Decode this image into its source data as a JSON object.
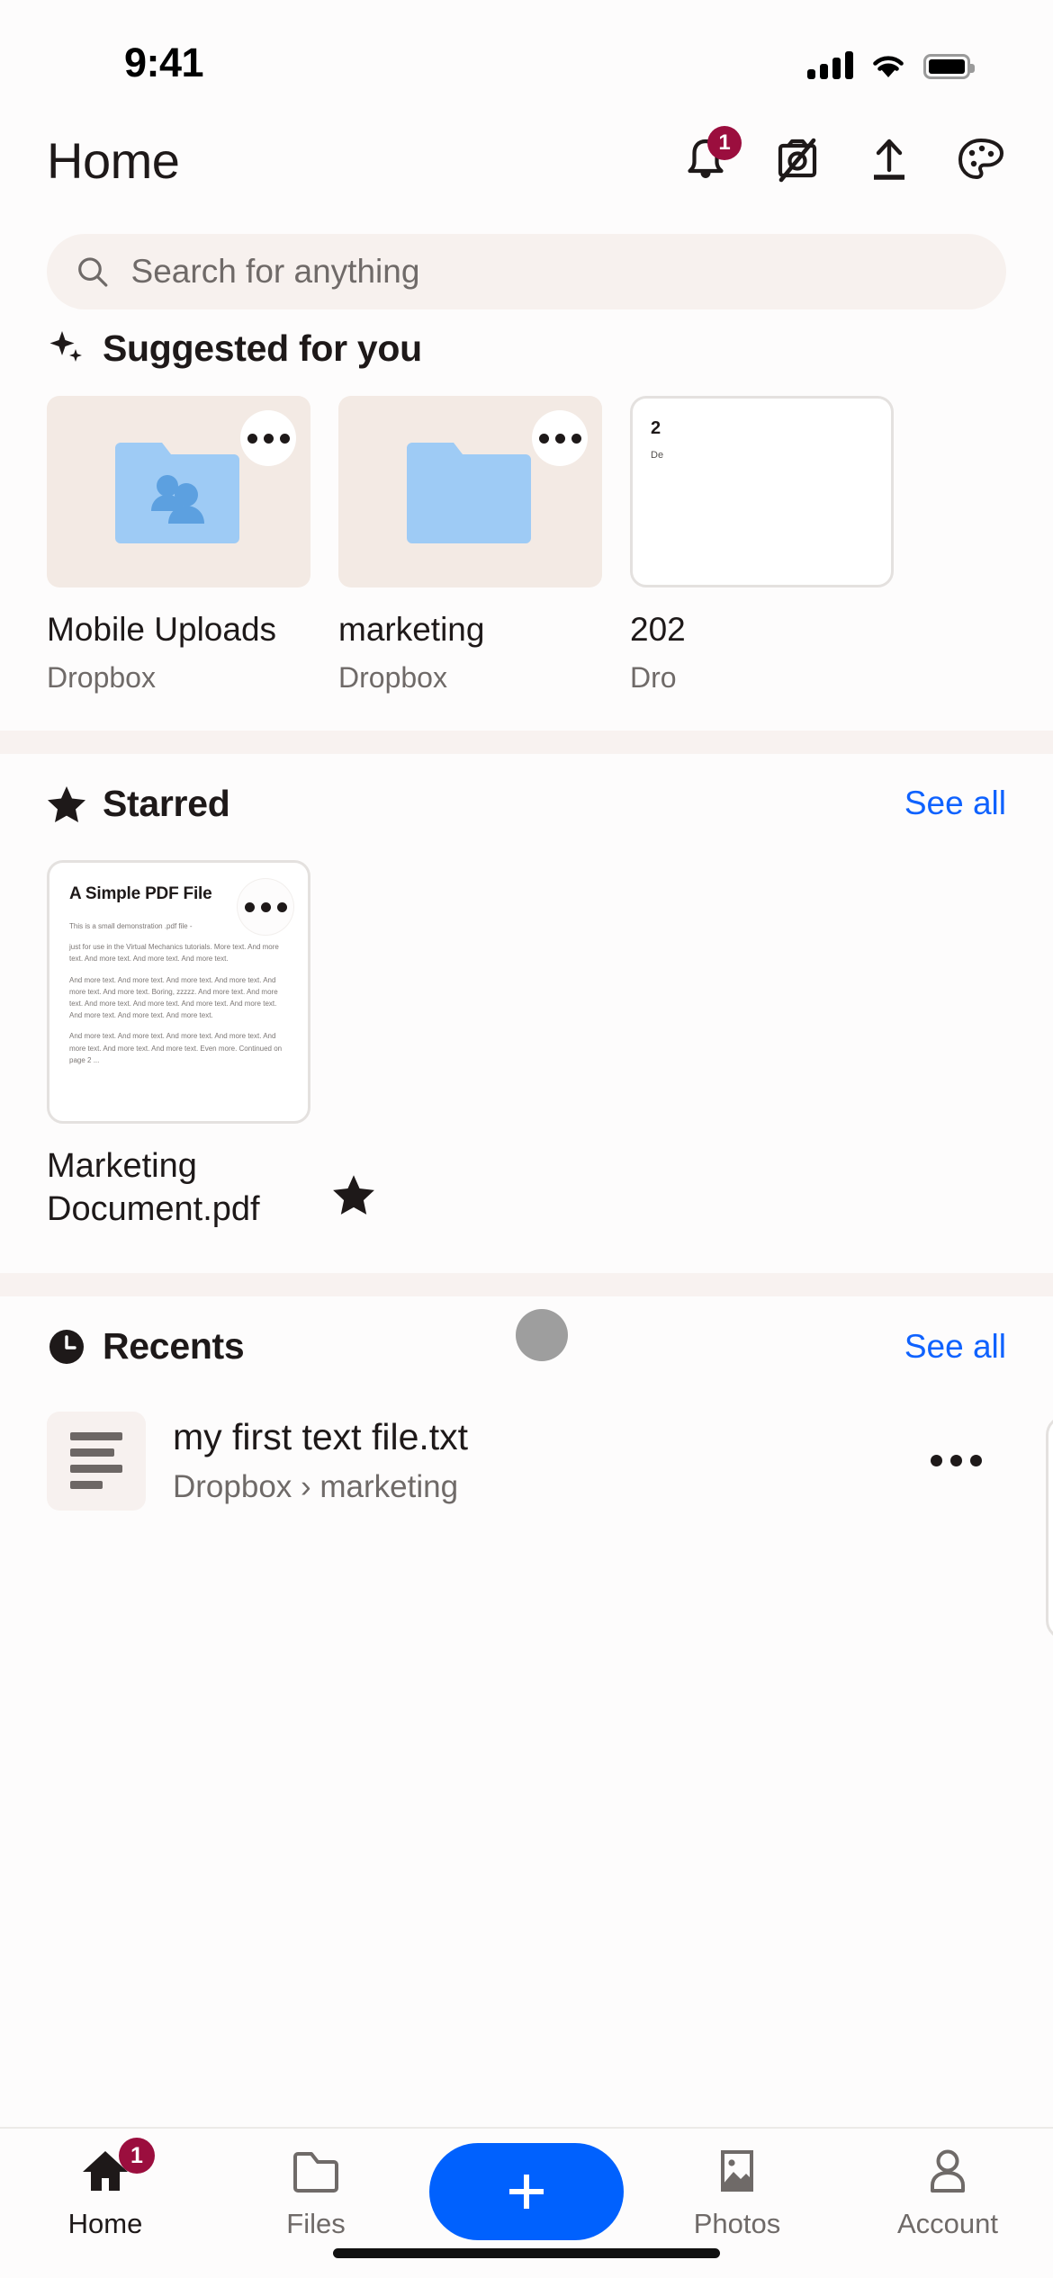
{
  "status_bar": {
    "time": "9:41",
    "cellular_icon": "signal-bars-icon",
    "wifi_icon": "wifi-icon",
    "battery_icon": "battery-full-icon"
  },
  "header": {
    "title": "Home",
    "actions": [
      {
        "name": "notifications-button",
        "icon": "bell-icon",
        "badge": "1"
      },
      {
        "name": "camera-uploads-button",
        "icon": "camera-slash-icon"
      },
      {
        "name": "upload-button",
        "icon": "upload-arrow-icon"
      },
      {
        "name": "theme-button",
        "icon": "palette-icon"
      }
    ]
  },
  "search": {
    "placeholder": "Search for anything",
    "value": "",
    "icon": "search-icon"
  },
  "suggested": {
    "title": "Suggested for you",
    "icon": "sparkle-icon",
    "cards": [
      {
        "name": "Mobile Uploads",
        "subtitle": "Dropbox",
        "kind": "shared-folder",
        "menu": "overflow-menu-icon"
      },
      {
        "name": "marketing",
        "subtitle": "Dropbox",
        "kind": "folder",
        "menu": "overflow-menu-icon"
      },
      {
        "name": "202",
        "subtitle": "Dro",
        "kind": "document",
        "doc_title": "2",
        "doc_sub": "De"
      }
    ]
  },
  "starred": {
    "title": "Starred",
    "icon": "star-icon",
    "see_all": "See all",
    "items": [
      {
        "name": "Marketing Document.pdf",
        "starred_icon": "star-filled-icon",
        "menu": "overflow-menu-icon",
        "preview": {
          "title": "A Simple PDF File",
          "paragraphs": [
            "This is a small demonstration .pdf file -",
            "just for use in the Virtual Mechanics tutorials. More text. And more text. And more text. And more text. And more text.",
            "And more text. And more text. And more text. And more text. And more text. And more text. Boring, zzzzz. And more text. And more text. And more text. And more text. And more text. And more text. And more text. And more text. And more text.",
            "And more text. And more text. And more text. And more text. And more text. And more text. And more text. Even more. Continued on page 2 ..."
          ]
        }
      }
    ]
  },
  "recents": {
    "title": "Recents",
    "icon": "clock-icon",
    "see_all": "See all",
    "items": [
      {
        "name": "my first text file.txt",
        "path": "Dropbox › marketing",
        "icon": "text-file-icon",
        "menu": "overflow-menu-icon"
      }
    ]
  },
  "tabbar": {
    "tabs": [
      {
        "label": "Home",
        "icon": "home-icon",
        "active": true,
        "badge": "1"
      },
      {
        "label": "Files",
        "icon": "folder-icon",
        "active": false
      },
      {
        "label": "",
        "icon": "plus-icon",
        "active": false,
        "is_fab": true
      },
      {
        "label": "Photos",
        "icon": "photo-icon",
        "active": false
      },
      {
        "label": "Account",
        "icon": "person-icon",
        "active": false
      }
    ]
  },
  "colors": {
    "accent_blue": "#0061fe",
    "link_blue": "#0f62fe",
    "badge_crimson": "#9b0e3e",
    "card_beige": "#f3eae4",
    "folder_blue": "#9ecbf5",
    "search_bg": "#f7f1ee"
  }
}
